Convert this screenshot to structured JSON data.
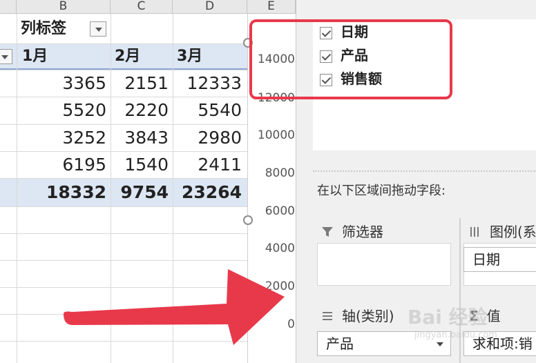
{
  "sheet": {
    "columns": [
      "B",
      "C",
      "D"
    ],
    "partial_column_letter": "E",
    "column_label_text": "列标签",
    "months": [
      "1月",
      "2月",
      "3月"
    ],
    "rows": [
      [
        "3365",
        "2151",
        "12333"
      ],
      [
        "5520",
        "2220",
        "5540"
      ],
      [
        "3252",
        "3843",
        "2980"
      ],
      [
        "6195",
        "1540",
        "2411"
      ]
    ],
    "totals": [
      "18332",
      "9754",
      "23264"
    ]
  },
  "chart": {
    "y_ticks": [
      "14000",
      "12000",
      "10000",
      "8000",
      "6000",
      "4000",
      "2000",
      "0"
    ]
  },
  "pane": {
    "fields": [
      "日期",
      "产品",
      "销售额"
    ],
    "drag_hint": "在以下区域间拖动字段:",
    "areas": {
      "filters": {
        "label": "筛选器",
        "icon": "filter-icon"
      },
      "legend": {
        "label": "图例(系",
        "icon": "columns-icon",
        "chip": "日期"
      },
      "axis": {
        "label": "轴(类别)",
        "icon": "rows-icon",
        "chip": "产品"
      },
      "values": {
        "label": "值",
        "icon": "sigma-icon",
        "chip": "求和项:销"
      }
    }
  },
  "watermark": {
    "text": "Bai 经验",
    "sub": "jingyan.baidu.com"
  },
  "colors": {
    "highlight": "#e8394a",
    "arrow": "#e8394a",
    "pivot_header": "#dde6f3"
  }
}
